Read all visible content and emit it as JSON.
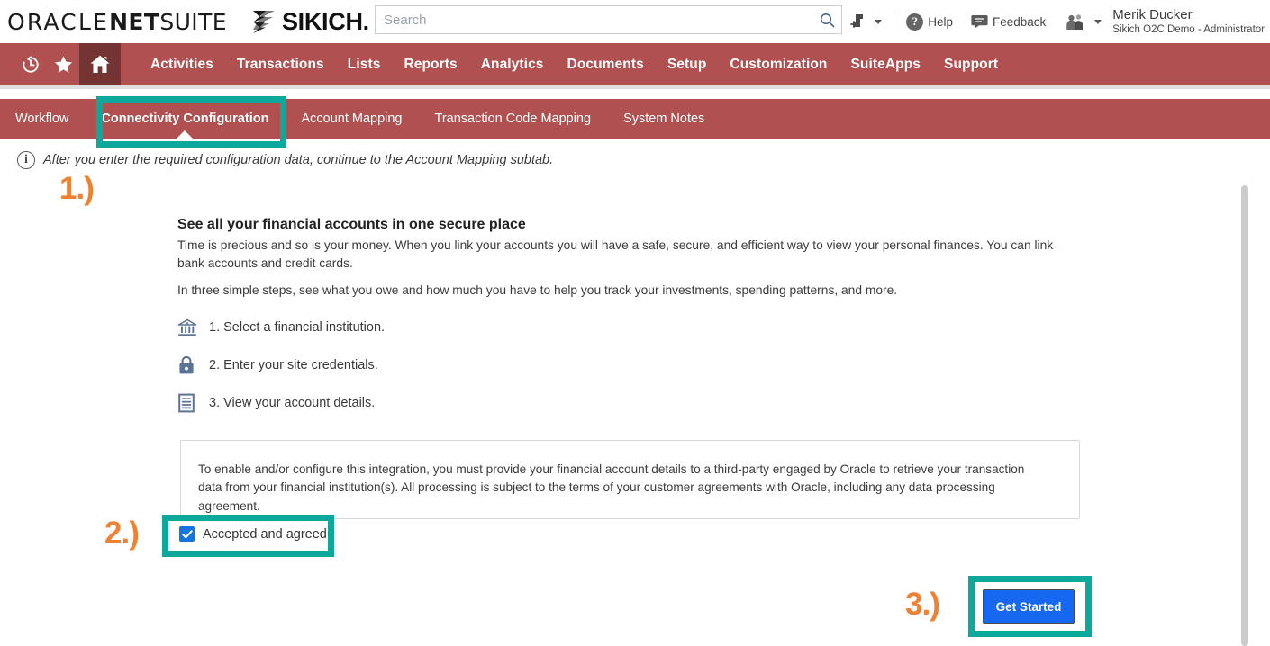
{
  "header": {
    "oracle_logo": {
      "oracle": "ORACLE",
      "net": "NET",
      "suite": "SUITE"
    },
    "partner_logo": {
      "name": "SIKICH.",
      "mark_icon": "sikich-chevron-mark"
    },
    "search": {
      "placeholder": "Search",
      "value": "",
      "icon": "search-icon"
    },
    "quick_add": {
      "icon": "add-shortcut-icon",
      "caret": "chevron-down-icon"
    },
    "help": {
      "label": "Help",
      "icon": "help-question-icon"
    },
    "feedback": {
      "label": "Feedback",
      "icon": "feedback-chat-icon"
    },
    "user": {
      "name": "Merik Ducker",
      "role": "Sikich O2C Demo - Administrator",
      "icon": "user-group-icon",
      "caret": "chevron-down-icon"
    }
  },
  "main_nav": {
    "icons": [
      {
        "name": "recent-history-icon",
        "label": "Recent Records"
      },
      {
        "name": "favorites-star-icon",
        "label": "Shortcuts"
      },
      {
        "name": "home-icon",
        "label": "Home",
        "active": true
      }
    ],
    "links": [
      "Activities",
      "Transactions",
      "Lists",
      "Reports",
      "Analytics",
      "Documents",
      "Setup",
      "Customization",
      "SuiteApps",
      "Support"
    ],
    "background_color": "#b05050",
    "active_background_color": "#743434"
  },
  "subtabs": {
    "items": [
      {
        "label": "Workflow",
        "active": false
      },
      {
        "label": "Connectivity Configuration",
        "active": true
      },
      {
        "label": "Account Mapping",
        "active": false
      },
      {
        "label": "Transaction Code Mapping",
        "active": false
      },
      {
        "label": "System Notes",
        "active": false
      }
    ]
  },
  "info_note": {
    "icon": "info-circle-icon",
    "glyph": "i",
    "text": "After you enter the required configuration data, continue to the Account Mapping subtab."
  },
  "content": {
    "heading": "See all your financial accounts in one secure place",
    "paragraph_1": "Time is precious and so is your money. When you link your accounts you will have a safe, secure, and efficient way to view your personal finances. You can link bank accounts and credit cards.",
    "paragraph_2": "In three simple steps, see what you owe and how much you have to help you track your investments, spending patterns, and more.",
    "steps": [
      {
        "icon": "bank-institution-icon",
        "label": "1. Select a financial institution."
      },
      {
        "icon": "lock-icon",
        "label": "2. Enter your site credentials."
      },
      {
        "icon": "document-list-icon",
        "label": "3. View your account details."
      }
    ],
    "disclaimer": "To enable and/or configure this integration, you must provide your financial account details to a third-party engaged by Oracle to retrieve your transaction data from your financial institution(s). All processing is subject to the terms of your customer agreements with Oracle, including any data processing agreement.",
    "checkbox": {
      "label": "Accepted and agreed",
      "checked": true,
      "color": "#1575e0"
    },
    "primary_button": {
      "label": "Get Started",
      "color": "#1668f0"
    }
  },
  "annotations": {
    "color": "#ef8133",
    "highlight_color": "#0da89c",
    "steps": [
      {
        "number": "1.)",
        "target": "subtab-connectivity-configuration"
      },
      {
        "number": "2.)",
        "target": "accepted-and-agreed-checkbox"
      },
      {
        "number": "3.)",
        "target": "get-started-button"
      }
    ]
  }
}
